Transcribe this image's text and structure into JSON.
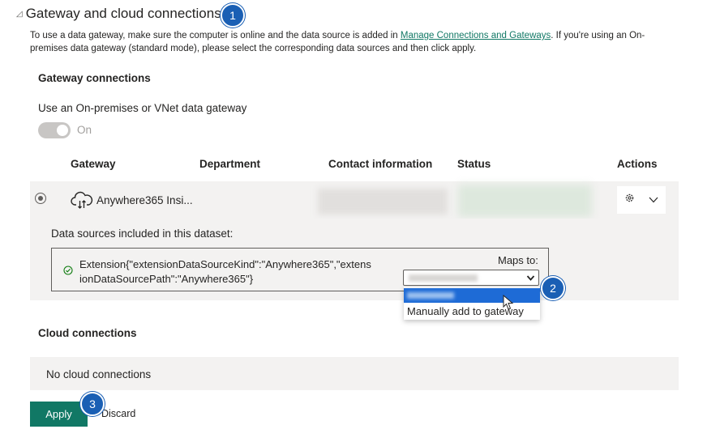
{
  "section": {
    "title": "Gateway and cloud connections",
    "description_before_link": "To use a data gateway, make sure the computer is online and the data source is added in ",
    "link_text": "Manage Connections and Gateways",
    "description_after_link": ". If you're using an On-premises data gateway (standard mode), please select the corresponding data sources and then click apply."
  },
  "gateway": {
    "heading": "Gateway connections",
    "toggle_question": "Use an On-premises or VNet data gateway",
    "toggle_state": "On",
    "columns": [
      "Gateway",
      "Department",
      "Contact information",
      "Status",
      "Actions"
    ],
    "row": {
      "name": "Anywhere365 Insi..."
    },
    "datasources_label": "Data sources included in this dataset:",
    "datasource_text": "Extension{\"extensionDataSourceKind\":\"Anywhere365\",\"extensionDataSourcePath\":\"Anywhere365\"}",
    "maps_to_label": "Maps to:",
    "dropdown_option_manual": "Manually add to gateway"
  },
  "cloud": {
    "heading": "Cloud connections",
    "empty_text": "No cloud connections"
  },
  "buttons": {
    "apply": "Apply",
    "discard": "Discard"
  },
  "callouts": [
    "1",
    "2",
    "3"
  ],
  "colors": {
    "accent": "#117865",
    "callout": "#1a5fb4",
    "selection": "#1e6bd6"
  }
}
